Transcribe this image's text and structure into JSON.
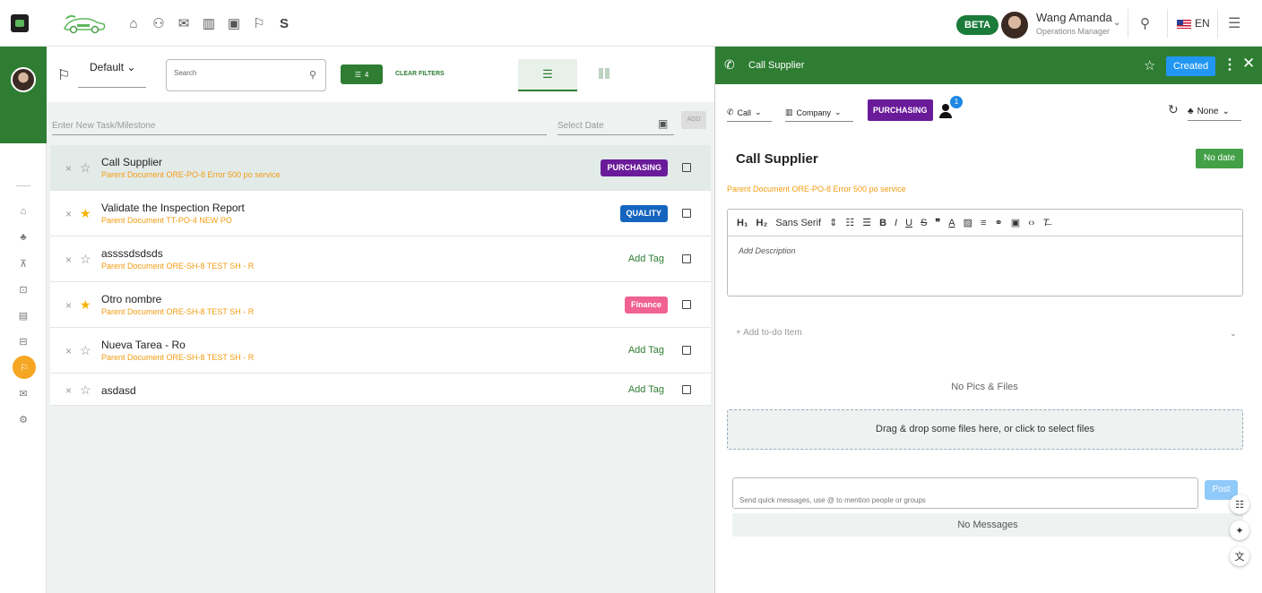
{
  "topbar": {
    "beta_label": "BETA",
    "user_name": "Wang Amanda",
    "user_role": "Operations Manager",
    "language": "EN",
    "shortcut_letter": "S"
  },
  "task_panel": {
    "view_name": "Default",
    "search_placeholder": "Search",
    "filter_count": "4",
    "clear_filters": "CLEAR FILTERS",
    "new_task_placeholder": "Enter New Task/Milestone",
    "date_placeholder": "Select Date",
    "add_label": "ADD",
    "tasks": [
      {
        "title": "Call Supplier",
        "parent": "Parent Document ORE-PO-8 Error 500 po service",
        "tag": "PURCHASING",
        "starred": false
      },
      {
        "title": "Validate the Inspection Report",
        "parent": "Parent Document TT-PO-4 NEW PO",
        "tag": "QUALITY",
        "starred": true
      },
      {
        "title": "assssdsdsds",
        "parent": "Parent Document ORE-SH-8 TEST SH - R",
        "tag": "Add Tag",
        "starred": false
      },
      {
        "title": "Otro nombre",
        "parent": "Parent Document ORE-SH-8 TEST SH - R",
        "tag": "Finance",
        "starred": true
      },
      {
        "title": "Nueva Tarea - Ro",
        "parent": "Parent Document ORE-SH-8 TEST SH - R",
        "tag": "Add Tag",
        "starred": false
      },
      {
        "title": "asdasd",
        "parent": "",
        "tag": "Add Tag",
        "starred": false
      }
    ]
  },
  "detail": {
    "header_title": "Call Supplier",
    "status": "Created",
    "type": "Call",
    "entity": "Company",
    "tag": "PURCHASING",
    "assignee_count": "1",
    "priority": "None",
    "title": "Call Supplier",
    "date_label": "No date",
    "parent": "Parent Document ORE-PO-8 Error 500 po service",
    "editor": {
      "h1": "H₁",
      "h2": "H₂",
      "font": "Sans Serif",
      "placeholder": "Add Description"
    },
    "add_todo": "+ Add to-do Item",
    "no_pics": "No Pics & Files",
    "dropzone": "Drag & drop some files here, or click to select files",
    "message_placeholder": "Send quick messages, use @ to mention people or groups",
    "post_label": "Post",
    "no_messages": "No Messages"
  },
  "colors": {
    "brand_green": "#2e7d32",
    "accent_orange": "#f39c12",
    "purchasing": "#6a1b9a",
    "quality": "#1565c0",
    "finance": "#f06292",
    "created_blue": "#2196f3"
  }
}
